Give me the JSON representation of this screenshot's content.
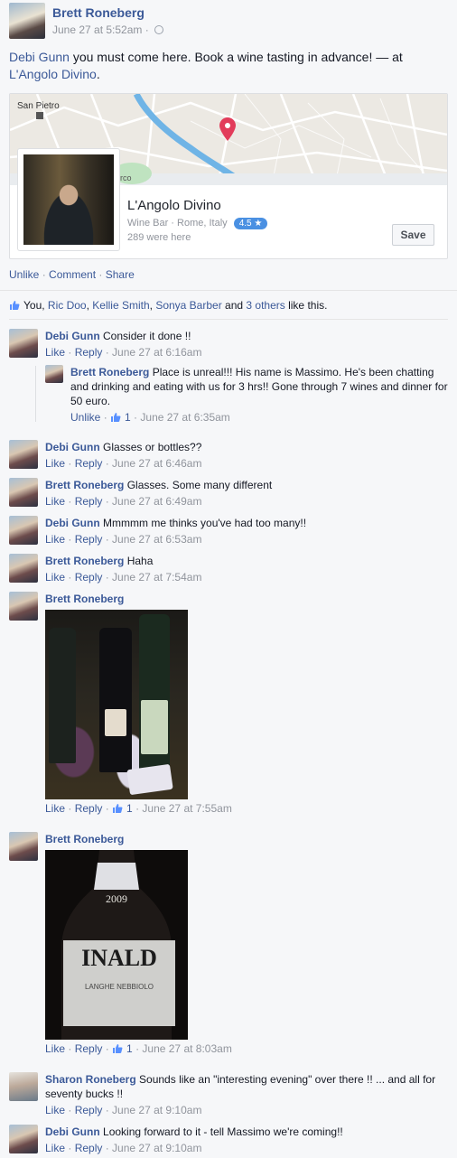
{
  "post": {
    "author": "Brett Roneberg",
    "time": "June 27 at 5:52am",
    "text_tag": "Debi Gunn",
    "text_body": " you must come here. Book a wine tasting in advance! — at ",
    "text_place": "L'Angolo Divino",
    "text_end": "."
  },
  "map": {
    "label": "San Pietro",
    "label2": "arco"
  },
  "place": {
    "name": "L'Angolo Divino",
    "category": "Wine Bar · Rome, Italy",
    "rating": "4.5 ★",
    "visits": "289 were here",
    "save_label": "Save"
  },
  "actions": {
    "unlike": "Unlike",
    "comment": "Comment",
    "share": "Share",
    "sep": " · "
  },
  "likes": {
    "you": "You, ",
    "n1": "Ric Doo",
    "n2": "Kellie Smith",
    "n3": "Sonya Barber",
    "and": " and ",
    "others": "3 others",
    "tail": " like this.",
    "comma": ", "
  },
  "comments": [
    {
      "name": "Debi Gunn",
      "text": "Consider it done !!",
      "a1": "Like",
      "a2": "Reply",
      "time": "June 27 at 6:16am"
    },
    {
      "name": "Brett Roneberg",
      "text": "Place is unreal!!! His name is Massimo. He's been chatting and drinking and eating with us for 3 hrs!! Gone through 7 wines and dinner for 50 euro.",
      "a1": "Unlike",
      "likes": "1",
      "time": "June 27 at 6:35am"
    },
    {
      "name": "Debi Gunn",
      "text": "Glasses or bottles??",
      "a1": "Like",
      "a2": "Reply",
      "time": "June 27 at 6:46am"
    },
    {
      "name": "Brett Roneberg",
      "text": "Glasses. Some many different",
      "a1": "Like",
      "a2": "Reply",
      "time": "June 27 at 6:49am"
    },
    {
      "name": "Debi Gunn",
      "text": "Mmmmm me thinks you've had too many!!",
      "a1": "Like",
      "a2": "Reply",
      "time": "June 27 at 6:53am"
    },
    {
      "name": "Brett Roneberg",
      "text": "Haha",
      "a1": "Like",
      "a2": "Reply",
      "time": "June 27 at 7:54am"
    },
    {
      "name": "Brett Roneberg",
      "text": "",
      "a1": "Like",
      "a2": "Reply",
      "likes": "1",
      "time": "June 27 at 7:55am"
    },
    {
      "name": "Brett Roneberg",
      "text": "",
      "a1": "Like",
      "a2": "Reply",
      "likes": "1",
      "time": "June 27 at 8:03am",
      "photo_text1": "INALD",
      "photo_text2": "2009",
      "photo_text3": "LANGHE NEBBIOLO"
    },
    {
      "name": "Sharon Roneberg",
      "text": "Sounds like an \"interesting evening\" over there !! ... and all for seventy bucks !!",
      "a1": "Like",
      "a2": "Reply",
      "time": "June 27 at 9:10am"
    },
    {
      "name": "Debi Gunn",
      "text": "Looking forward to it - tell Massimo we're coming!!",
      "a1": "Like",
      "a2": "Reply",
      "time": "June 27 at 9:10am"
    }
  ],
  "sep": " · "
}
